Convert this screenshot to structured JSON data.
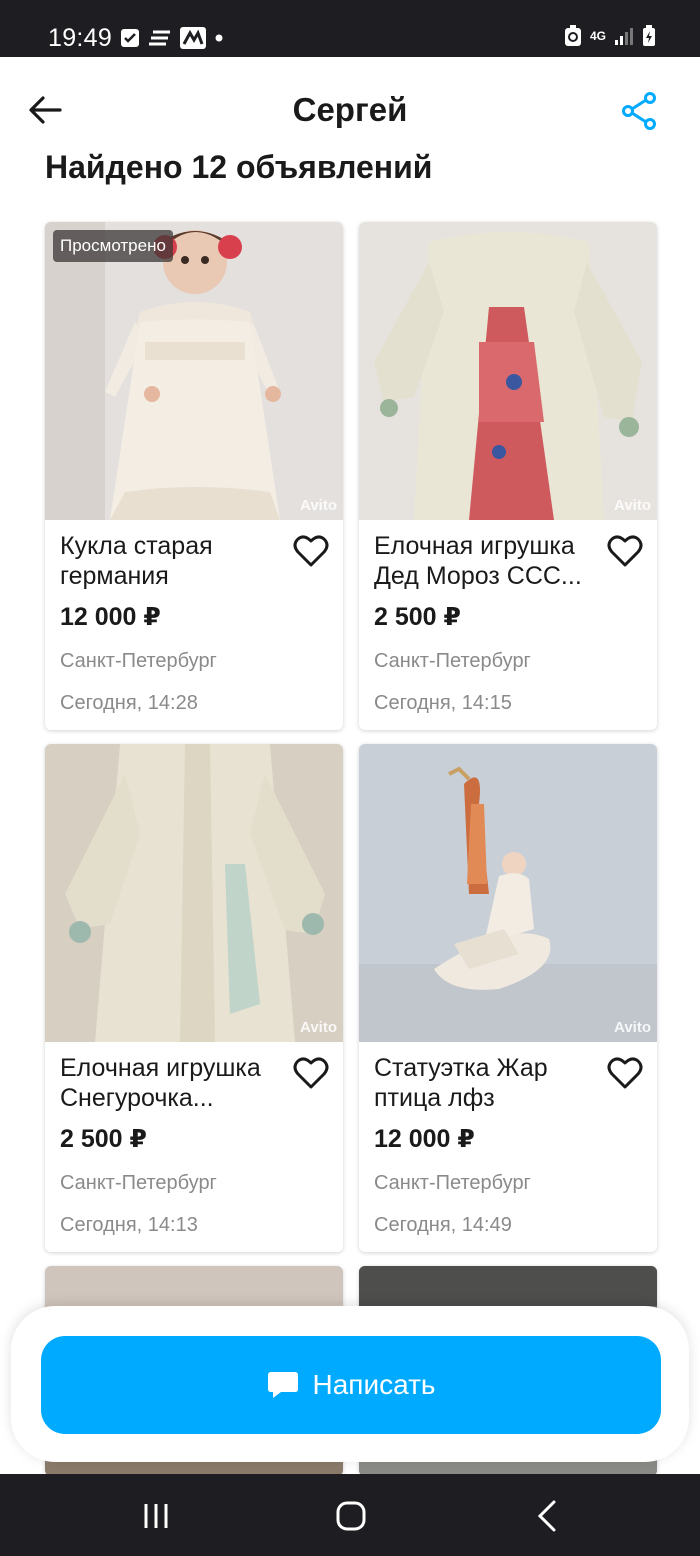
{
  "status_bar": {
    "time": "19:49",
    "network": "4G"
  },
  "header": {
    "title": "Сергей"
  },
  "section": {
    "title": "Найдено 12 объявлений"
  },
  "listings": [
    {
      "title": "Кукла старая германия",
      "price": "12 000 ₽",
      "city": "Санкт-Петербург",
      "date": "Сегодня, 14:28",
      "badge": "Просмотрено",
      "watermark": "Avito"
    },
    {
      "title": "Елочная игрушка Дед Мороз ССС...",
      "price": "2 500 ₽",
      "city": "Санкт-Петербург",
      "date": "Сегодня, 14:15",
      "watermark": "Avito"
    },
    {
      "title": "Елочная игрушка Снегурочка...",
      "price": "2 500 ₽",
      "city": "Санкт-Петербург",
      "date": "Сегодня, 14:13",
      "watermark": "Avito"
    },
    {
      "title": "Статуэтка Жар птица лфз",
      "price": "12 000 ₽",
      "city": "Санкт-Петербург",
      "date": "Сегодня, 14:49",
      "watermark": "Avito"
    }
  ],
  "actions": {
    "write_label": "Написать"
  },
  "colors": {
    "accent": "#00aaff",
    "status_bar": "#1e1e22",
    "text_muted": "#8a8a8a"
  }
}
